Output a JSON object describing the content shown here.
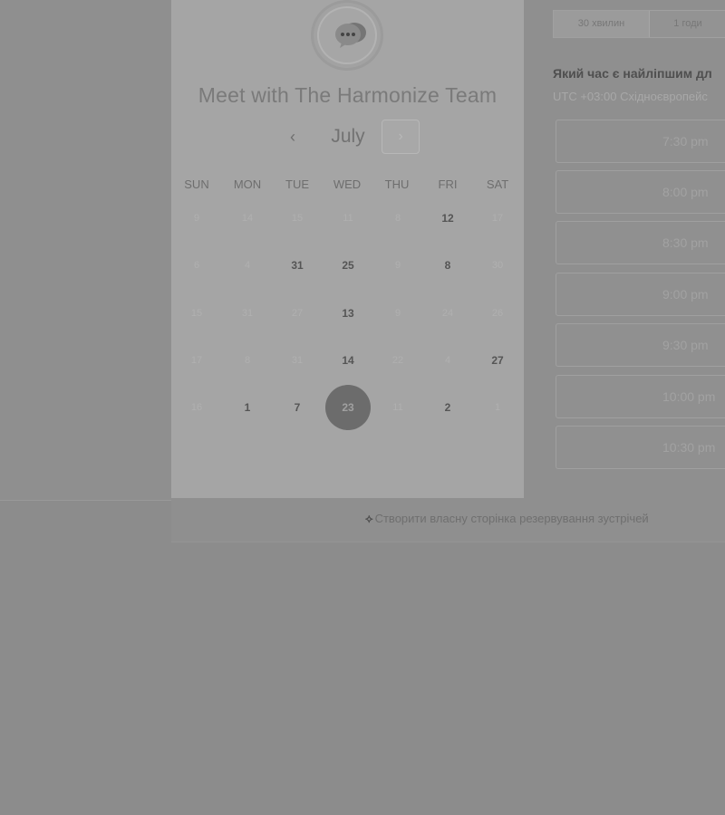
{
  "booking": {
    "team_title": "Meet with The Harmonize Team",
    "month": "July",
    "prev_icon": "‹",
    "next_icon": "›",
    "weekdays": [
      "SUN",
      "MON",
      "TUE",
      "WED",
      "THU",
      "FRI",
      "SAT"
    ],
    "days": [
      [
        "9",
        "14",
        "15",
        "11",
        "8",
        "12",
        "17"
      ],
      [
        "6",
        "4",
        "31",
        "25",
        "9",
        "8",
        "30"
      ],
      [
        "15",
        "31",
        "27",
        "13",
        "9",
        "24",
        "26"
      ],
      [
        "17",
        "8",
        "31",
        "14",
        "22",
        "4",
        "27"
      ],
      [
        "16",
        "1",
        "7",
        "23",
        "11",
        "2",
        "1"
      ]
    ],
    "selected_day": "23"
  },
  "durations": {
    "tab_1": "30 хвилин",
    "tab_2": "1 годи"
  },
  "schedule": {
    "question": "Який час є найліпшим дл",
    "timezone": "UTC +03:00 Східноєвропейс",
    "slots": [
      "7:30 pm",
      "8:00 pm",
      "8:30 pm",
      "9:00 pm",
      "9:30 pm",
      "10:00 pm",
      "10:30 pm"
    ]
  },
  "footer": {
    "link_text": "Створити власну сторінка резервування зустрічей"
  },
  "icons": {
    "avatar": "chat-bubble-icon",
    "footer": "sparkle-icon"
  }
}
